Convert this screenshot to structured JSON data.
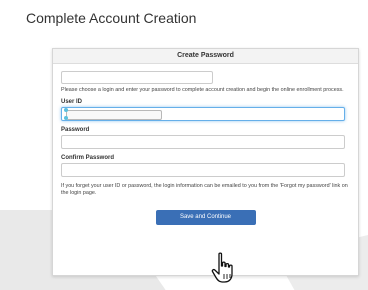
{
  "page": {
    "title": "Complete Account Creation"
  },
  "panel": {
    "header": "Create Password",
    "intro": "Please choose a login and enter your password to complete account creation and begin the online enrollment process.",
    "user_id_label": "User ID",
    "password_label": "Password",
    "confirm_password_label": "Confirm Password",
    "note": "If you forget your user ID or password, the login information can be emailed to you from the 'Forgot my password' link on the login page.",
    "save_label": "Save and Continue"
  },
  "colors": {
    "button": "#3a6fb6",
    "focus_border": "#66afe9"
  },
  "icons": {
    "cursor": "hand-pointer-icon"
  }
}
